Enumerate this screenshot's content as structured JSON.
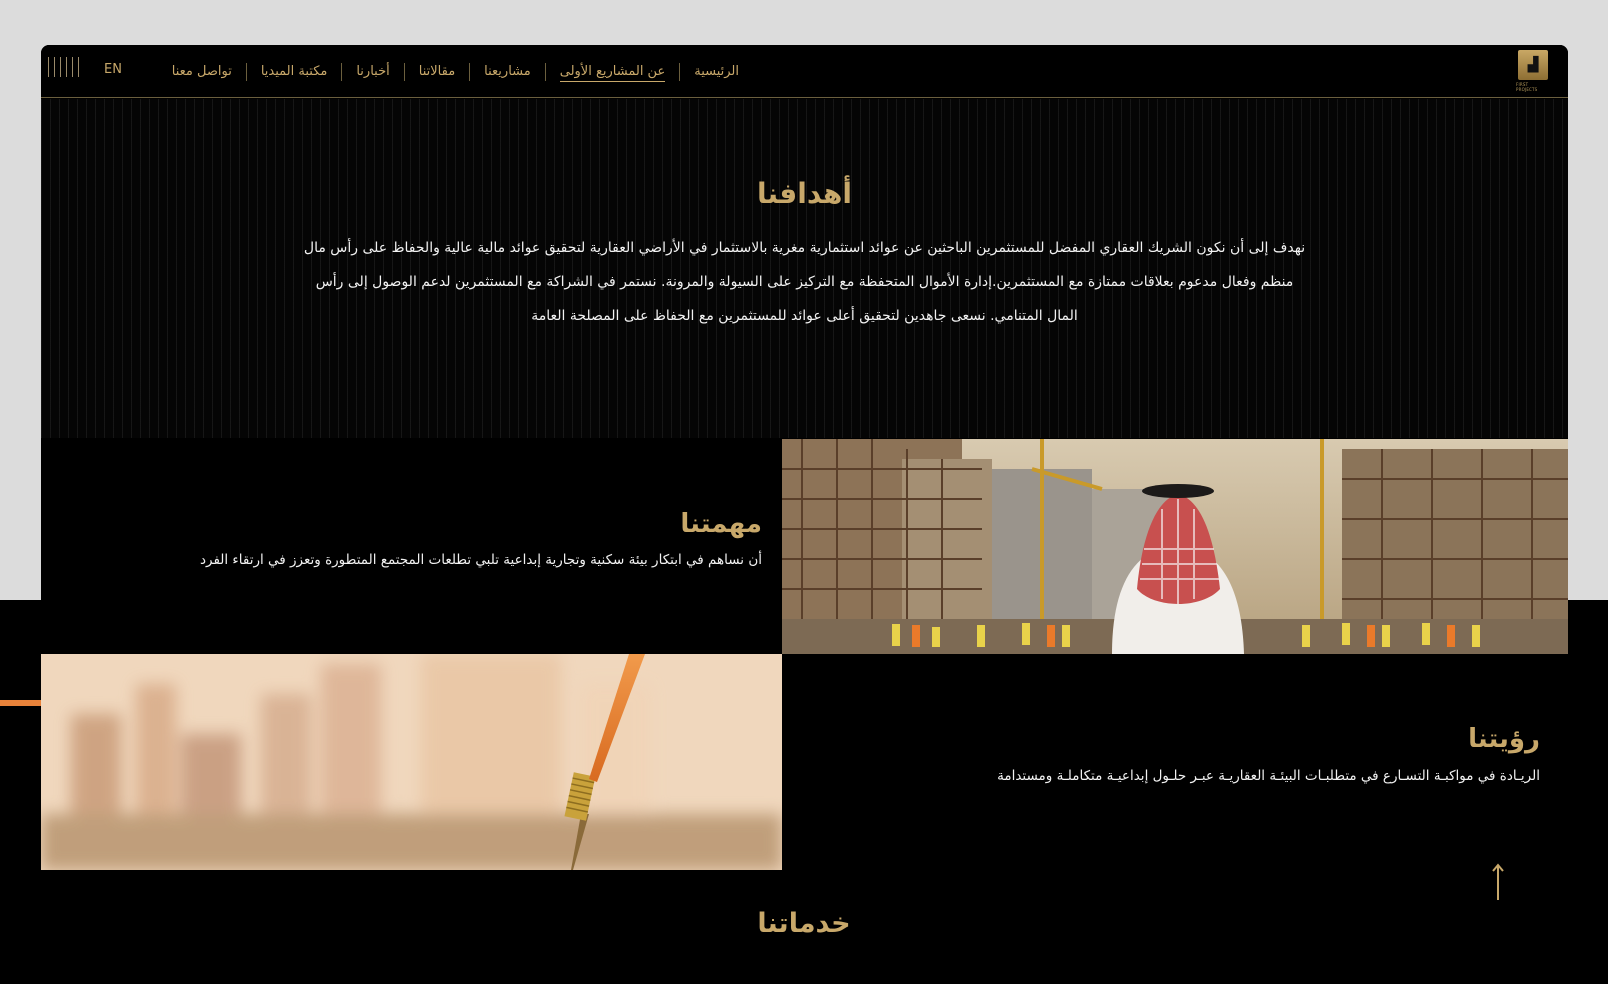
{
  "nav": {
    "items": [
      {
        "label": "الرئيسية",
        "active": false
      },
      {
        "label": "عن المشاريع الأولى",
        "active": true
      },
      {
        "label": "مشاريعنا",
        "active": false
      },
      {
        "label": "مقالاتنا",
        "active": false
      },
      {
        "label": "أخبارنا",
        "active": false
      },
      {
        "label": "مكتبة الميديا",
        "active": false
      },
      {
        "label": "تواصل معنا",
        "active": false
      }
    ],
    "lang": "EN",
    "logo_text": "FIRST PROJECTS"
  },
  "goals": {
    "title": "أهدافنا",
    "text": "نهدف إلى أن نكون الشريك العقاري المفضل للمستثمرين الباحثين عن عوائد استثمارية مغرية بالاستثمار في الأراضي العقارية لتحقيق عوائد مالية عالية والحفاظ على رأس مال منظم وفعال مدعوم بعلاقات ممتازة مع المستثمرين.إدارة الأموال المتحفظة مع التركيز على السيولة والمرونة. نستمر في الشراكة مع المستثمرين لدعم الوصول إلى رأس المال المتنامي. نسعى جاهدين لتحقيق أعلى عوائد للمستثمرين مع الحفاظ على المصلحة العامة"
  },
  "mission": {
    "title": "مهمتنا",
    "text": "أن نساهم في ابتكار بيئة سكنية وتجارية إبداعية تلبي تطلعات المجتمع المتطورة وتعزز في ارتقاء الفرد"
  },
  "vision": {
    "title": "رؤيتنا",
    "text": "الريـادة في مواكبـة التسـارع في متطلبـات البيئـة العقاريـة عبـر حلـول إبداعيـة متكاملـة ومستدامة"
  },
  "services": {
    "title": "خدماتنا"
  },
  "colors": {
    "accent_gold": "#c8a86a",
    "accent_orange": "#e8823a",
    "background": "#000000"
  },
  "icons": {
    "up": "up-arrow-icon",
    "menu": "menu-lines-icon"
  }
}
